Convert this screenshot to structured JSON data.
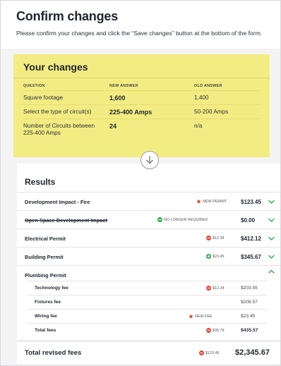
{
  "header": {
    "title": "Confirm changes",
    "subtitle": "Please confirm your changes and click the “Save changes” button at the bottom of the form."
  },
  "changes": {
    "title": "Your changes",
    "columns": {
      "question": "QUESTION",
      "new_answer": "NEW ANSWER",
      "old_answer": "OLD ANSWER"
    },
    "rows": [
      {
        "question": "Square footage",
        "new": "1,600",
        "old": "1,400"
      },
      {
        "question": "Select the type of circuit(s)",
        "new": "225-400 Amps",
        "old": "50-200 Amps"
      },
      {
        "question": "Number of Circuits between 225-400 Amps",
        "new": "24",
        "old": "n/a"
      }
    ],
    "background_color": "#f3ec82"
  },
  "divider_icon": "arrow-down-circle-icon",
  "results": {
    "title": "Results",
    "items": [
      {
        "label": "Development Impact - Fire",
        "badge_type": "new",
        "badge_text": "NEW PERMIT",
        "amount": "$123.45",
        "chevron": "down"
      },
      {
        "label": "Open Space Development Impact",
        "badge_type": "removed",
        "badge_text": "NO LONGER REQUIRED",
        "amount": "$0.00",
        "chevron": "down",
        "strikethrough": true
      },
      {
        "label": "Electrical Permit",
        "badge_type": "decrease",
        "badge_text": "$12.34",
        "amount": "$412.12",
        "chevron": "down"
      },
      {
        "label": "Building Permit",
        "badge_type": "increase",
        "badge_text": "$23.45",
        "amount": "$345.67",
        "chevron": "down"
      },
      {
        "label": "Plumbing Permit",
        "badge_type": "",
        "badge_text": "",
        "amount": "",
        "chevron": "up"
      }
    ],
    "plumbing_details": [
      {
        "label": "Technology fee",
        "badge_type": "decrease",
        "badge_text": "$12.34",
        "amount": "$203.55"
      },
      {
        "label": "Fixtures fee",
        "badge_type": "",
        "badge_text": "",
        "amount": "$208.57"
      },
      {
        "label": "Wiring fee",
        "badge_type": "new",
        "badge_text": "NEW FEE",
        "amount": "$23.45"
      },
      {
        "label": "Total fees",
        "badge_type": "decrease",
        "badge_text": "$35.79",
        "amount": "$435.57"
      }
    ],
    "total": {
      "label": "Total revised fees",
      "badge_type": "decrease",
      "badge_text": "$123.45",
      "amount": "$2,345.67"
    }
  },
  "colors": {
    "red": "#e2453c",
    "green": "#34a853",
    "text": "#1f2430",
    "yellow": "#f3ec82"
  }
}
